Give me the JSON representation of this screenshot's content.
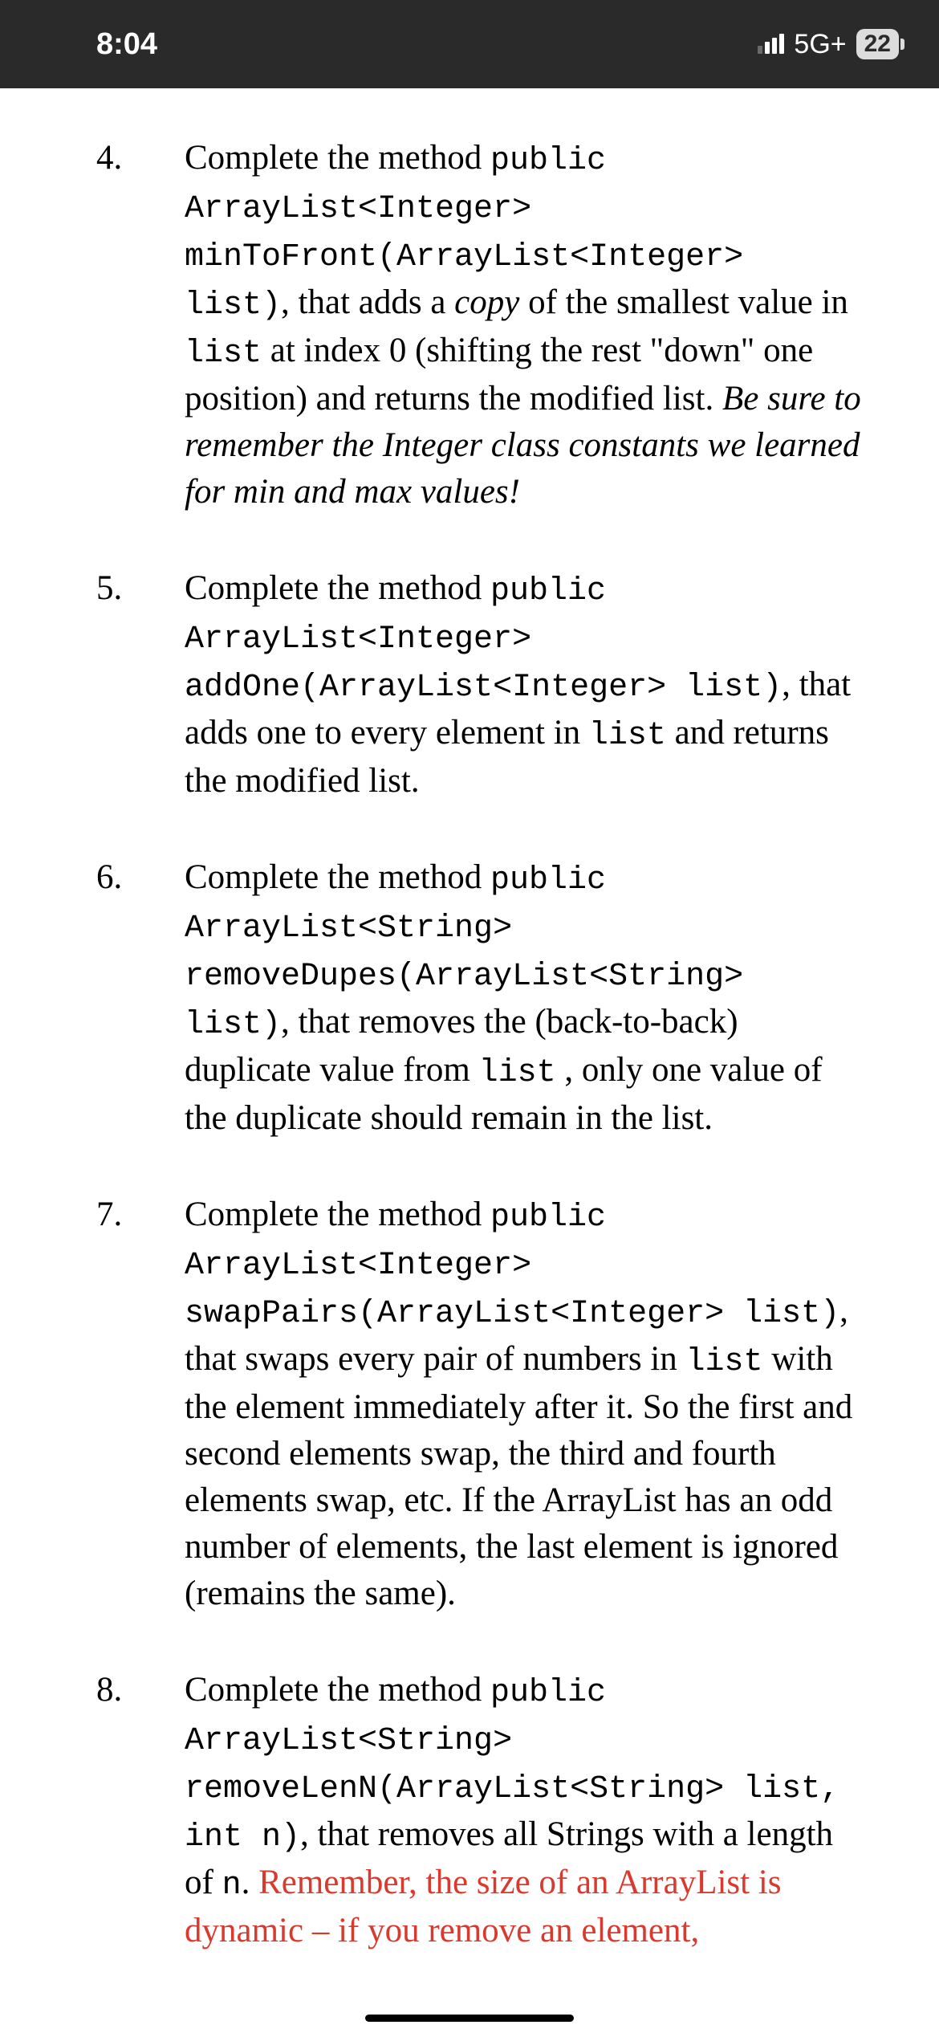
{
  "status": {
    "time": "8:04",
    "network": "5G+",
    "battery": "22"
  },
  "items": [
    {
      "num": "4.",
      "lead": "Complete the method ",
      "code1": "public ArrayList<Integer> minToFront(ArrayList<Integer> list)",
      "after_code1": ",  that adds a ",
      "ital1": "copy",
      "mid1": " of the smallest value in ",
      "code2": "list",
      "mid2": " at index 0 (shifting the rest \"down\" one position) and returns the modified list. ",
      "ital2": "Be sure to remember the Integer class constants we learned for min and max values!"
    },
    {
      "num": "5.",
      "lead": "Complete the method ",
      "code1": "public ArrayList<Integer> addOne(ArrayList<Integer> list)",
      "after_code1": ",  that adds one to every element in ",
      "code2": "list",
      "mid1": " and returns the modified list."
    },
    {
      "num": "6.",
      "lead": "Complete the method ",
      "code1": "public ArrayList<String> removeDupes(ArrayList<String> list)",
      "after_code1": ",  that removes the (back-to-back) duplicate value from ",
      "code2": "list",
      "mid1": " ,   only one value of the duplicate should remain in the list."
    },
    {
      "num": "7.",
      "lead": "Complete the method ",
      "code1": "public ArrayList<Integer> swapPairs(ArrayList<Integer> list)",
      "after_code1": ",  that swaps every pair of numbers in ",
      "code2": "list",
      "mid1": " with the element immediately after it. So the first and second elements swap, the third and fourth elements swap, etc. If the ArrayList has an odd number of elements, the last element is ignored (remains the same)."
    },
    {
      "num": "8.",
      "lead": "Complete the method ",
      "code1": "public ArrayList<String> removeLenN(ArrayList<String> list, int n)",
      "after_code1": ",  that removes all Strings with a length of ",
      "code2": "n",
      "mid1": ".  ",
      "red1": "Remember, the size of an ArrayList is dynamic – if you remove an element,"
    }
  ]
}
